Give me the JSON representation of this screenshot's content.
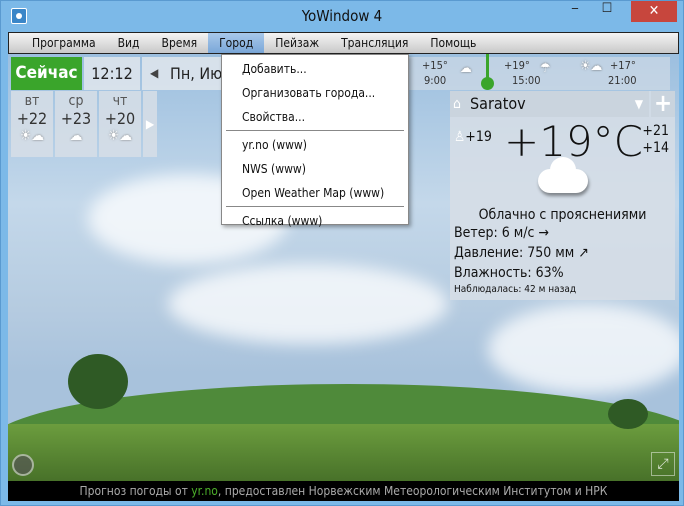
{
  "window": {
    "title": "YoWindow 4",
    "minimize": "‒",
    "maximize": "☐",
    "close": "✕"
  },
  "menu": [
    "Программа",
    "Вид",
    "Время",
    "Город",
    "Пейзаж",
    "Трансляция",
    "Помощь"
  ],
  "city_menu": {
    "items": [
      "Добавить...",
      "Организовать города...",
      "Свойства..."
    ],
    "sources": [
      "yr.no (www)",
      "NWS (www)",
      "Open Weather Map (www)"
    ],
    "link": "Ссылка (www)"
  },
  "toolbar": {
    "now": "Сейчас",
    "time": "12:12",
    "date": "Пн, Ию"
  },
  "forecast_days": [
    {
      "day": "вт",
      "temp": "+22",
      "icon": "partly-cloudy"
    },
    {
      "day": "ср",
      "temp": "+23",
      "icon": "cloudy"
    },
    {
      "day": "чт",
      "temp": "+20",
      "icon": "partly-cloudy"
    }
  ],
  "timeline": [
    {
      "temp": "+15°",
      "time": "9:00",
      "icon": "cloudy"
    },
    {
      "temp": "+19°",
      "time": "15:00",
      "icon": "rain"
    },
    {
      "temp": "+17°",
      "time": "21:00",
      "icon": "partly-cloudy"
    }
  ],
  "current": {
    "city": "Saratov",
    "feels_like": "+19",
    "temp": "+19°C",
    "high": "+21",
    "low": "+14",
    "description": "Облачно с прояснениями",
    "wind": "Ветер:  6 м/с →",
    "pressure": "Давление:  750 мм ↗",
    "humidity": "Влажность:  63%",
    "observed": "Наблюдалась:  42 м назад"
  },
  "footer": {
    "prefix": "Прогноз погоды от ",
    "link": "yr.no",
    "suffix": ", предоставлен Норвежским Метеорологическим Институтом и НРК"
  }
}
